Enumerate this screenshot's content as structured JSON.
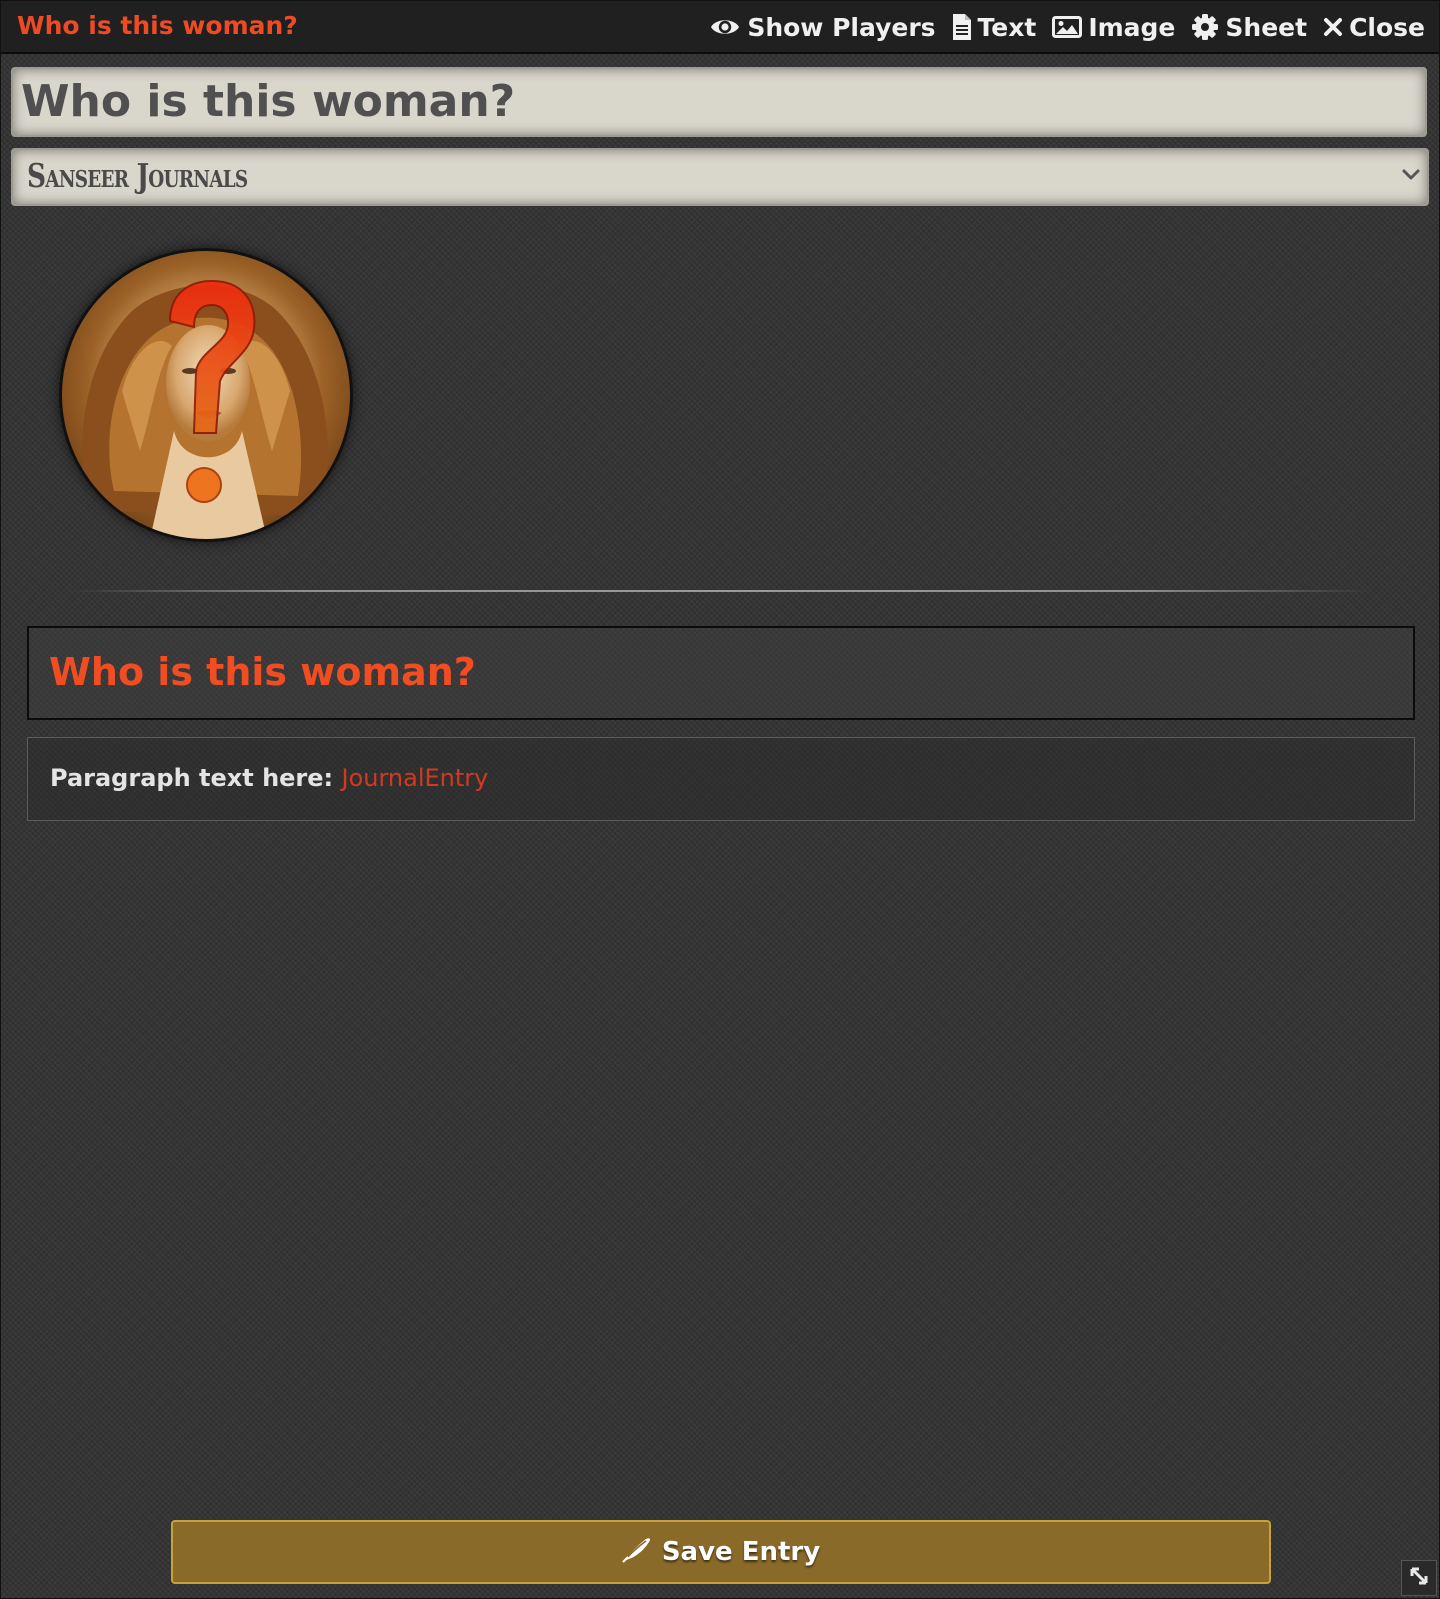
{
  "window": {
    "title": "Who is this woman?"
  },
  "header": {
    "controls": [
      {
        "icon": "eye-icon",
        "label": "Show Players"
      },
      {
        "icon": "file-text-icon",
        "label": "Text"
      },
      {
        "icon": "image-icon",
        "label": "Image"
      },
      {
        "icon": "gear-icon",
        "label": "Sheet"
      },
      {
        "icon": "close-icon",
        "label": "Close"
      }
    ]
  },
  "form": {
    "title_value": "Who is this woman?",
    "folder_value": "Sanseer Journals"
  },
  "content": {
    "heading": "Who is this woman?",
    "paragraph_prefix": "Paragraph text here: ",
    "paragraph_link": "JournalEntry"
  },
  "footer": {
    "save_label": "Save Entry",
    "save_icon": "feather-icon"
  },
  "colors": {
    "accent_red": "#ee4b25",
    "save_button": "#8a6a29",
    "input_bg": "#d9d7cc"
  }
}
